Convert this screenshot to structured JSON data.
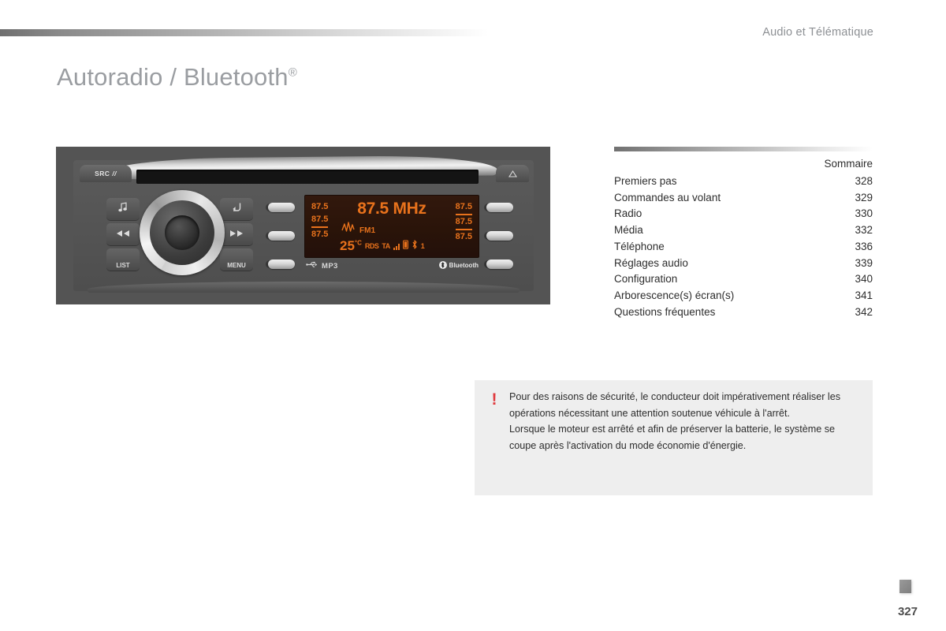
{
  "header": {
    "section_title": "Audio et Télématique"
  },
  "page_title": {
    "text": "Autoradio / Bluetooth",
    "superscript": "®"
  },
  "radio_unit": {
    "source_button_label": "SRC",
    "source_button_icon": "power-bars-icon",
    "eject_icon": "eject-triangle-icon",
    "cd_slot": "cd-slot",
    "buttons": [
      {
        "name": "music-note-button",
        "label": "♫",
        "icon": "music-note-icon"
      },
      {
        "name": "back-button",
        "label": "↰",
        "icon": "return-arrow-icon"
      },
      {
        "name": "rewind-button",
        "label": "◀◀",
        "icon": "rewind-icon"
      },
      {
        "name": "fast-forward-button",
        "label": "▶▶",
        "icon": "fast-forward-icon"
      },
      {
        "name": "list-button",
        "label": "LIST",
        "icon": "list-icon"
      },
      {
        "name": "menu-button",
        "label": "MENU",
        "icon": "menu-icon"
      }
    ],
    "rotary_knob": "volume-rotary-knob",
    "preset_buttons_left": [
      "preset-1",
      "preset-2",
      "preset-3"
    ],
    "preset_buttons_right": [
      "preset-4",
      "preset-5",
      "preset-6"
    ],
    "display": {
      "frequency": "87.5 MHz",
      "band": "FM1",
      "temperature": "25",
      "temperature_unit": "°C",
      "rds_tag": "RDS",
      "ta_tag": "TA",
      "phone_index": "1",
      "presets_left": [
        "87.5",
        "87.5",
        "87.5"
      ],
      "presets_right": [
        "87.5",
        "87.5",
        "87.5"
      ],
      "screen_color": "#e8721c",
      "screen_background": "#2a1409"
    },
    "footer_left_label": "MP3",
    "footer_left_icon": "usb-icon",
    "footer_right_label": "Bluetooth",
    "footer_right_icon": "bluetooth-icon"
  },
  "summary": {
    "heading": "Sommaire",
    "entries": [
      {
        "label": "Premiers pas",
        "page": "328"
      },
      {
        "label": "Commandes au volant",
        "page": "329"
      },
      {
        "label": "Radio",
        "page": "330"
      },
      {
        "label": "Média",
        "page": "332"
      },
      {
        "label": "Téléphone",
        "page": "336"
      },
      {
        "label": "Réglages audio",
        "page": "339"
      },
      {
        "label": "Configuration",
        "page": "340"
      },
      {
        "label": "Arborescence(s) écran(s)",
        "page": "341"
      },
      {
        "label": "Questions fréquentes",
        "page": "342"
      }
    ]
  },
  "warning": {
    "icon": "exclamation-icon",
    "icon_color": "#e03a3e",
    "paragraph_1": "Pour des raisons de sécurité, le conducteur doit impérativement réaliser les opérations nécessitant une attention soutenue véhicule à l'arrêt.",
    "paragraph_2": "Lorsque le moteur est arrêté et afin de préserver la batterie, le système se coupe après l'activation du mode économie d'énergie."
  },
  "footer": {
    "page_number": "327",
    "tab_marker": "chapter-tab-marker"
  }
}
